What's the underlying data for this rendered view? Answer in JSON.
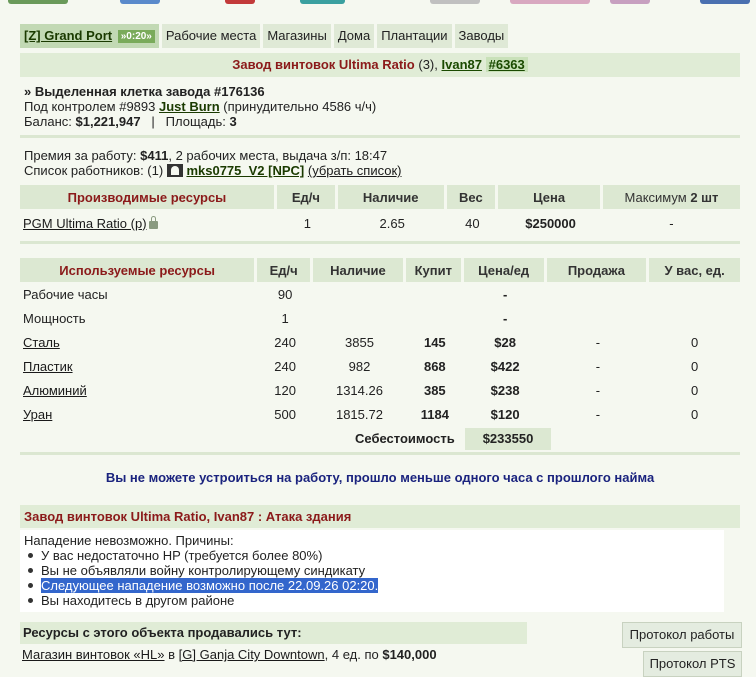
{
  "tabs": [
    {
      "label": "[Z] Grand Port",
      "timer": "»0:20»",
      "active": true
    },
    {
      "label": "Рабочие места"
    },
    {
      "label": "Магазины"
    },
    {
      "label": "Дома"
    },
    {
      "label": "Плантации"
    },
    {
      "label": "Заводы"
    }
  ],
  "title": {
    "name": "Завод винтовок Ultima Ratio",
    "count": "(3),",
    "owner": "Ivan87",
    "id": "#6363"
  },
  "info": {
    "cell_prefix": "» Выделенная клетка завода #176136",
    "control_prefix": "Под контролем #9893",
    "controller": "Just Burn",
    "control_suffix": "(принудительно 4586 ч/ч)",
    "balance_label": "Баланс:",
    "balance": "$1,221,947",
    "divider": "|",
    "area_label": "Площадь:",
    "area": "3"
  },
  "work": {
    "bonus_label": "Премия за работу:",
    "bonus": "$411",
    "bonus_rest": ", 2 рабочих места, выдача з/п: 18:47",
    "workers_label": "Список работников: (1)",
    "worker": "mks0775_V2 [NPC]",
    "remove_link": "(убрать список)"
  },
  "produced": {
    "headers": [
      "Производимые ресурсы",
      "Ед/ч",
      "Наличие",
      "Вес",
      "Цена"
    ],
    "max_label": "Максимум",
    "max_value": "2 шт",
    "rows": [
      {
        "name": "PGM Ultima Ratio (p)",
        "rate": "1",
        "stock": "2.65",
        "weight": "40",
        "price": "$250000",
        "max": "-"
      }
    ]
  },
  "used": {
    "headers": [
      "Используемые ресурсы",
      "Ед/ч",
      "Наличие",
      "Купит",
      "Цена/ед",
      "Продажа",
      "У вас, ед."
    ],
    "rows": [
      {
        "name": "Рабочие часы",
        "rate": "90",
        "stock": "",
        "buy": "",
        "price": "-",
        "sell": "",
        "have": "",
        "link": false
      },
      {
        "name": "Мощность",
        "rate": "1",
        "stock": "",
        "buy": "",
        "price": "-",
        "sell": "",
        "have": "",
        "link": false
      },
      {
        "name": "Сталь",
        "rate": "240",
        "stock": "3855",
        "buy": "145",
        "price": "$28",
        "sell": "-",
        "have": "0",
        "link": true
      },
      {
        "name": "Пластик",
        "rate": "240",
        "stock": "982",
        "buy": "868",
        "price": "$422",
        "sell": "-",
        "have": "0",
        "link": true
      },
      {
        "name": "Алюминий",
        "rate": "120",
        "stock": "1314.26",
        "buy": "385",
        "price": "$238",
        "sell": "-",
        "have": "0",
        "link": true
      },
      {
        "name": "Уран",
        "rate": "500",
        "stock": "1815.72",
        "buy": "1184",
        "price": "$120",
        "sell": "-",
        "have": "0",
        "link": true
      }
    ],
    "cost_label": "Себестоимость",
    "cost_value": "$233550"
  },
  "notice": "Вы не можете устроиться на работу, прошло меньше одного часа с прошлого найма",
  "attack": {
    "title": "Завод винтовок Ultima Ratio, Ivan87 : Атака здания",
    "header": "Нападение невозможно. Причины:",
    "reasons": [
      "У вас недостаточно HP (требуется более 80%)",
      "Вы не объявляли войну контролирующему синдикату",
      "Следующее нападение возможно после 22.09.26 02:20.",
      "Вы находитесь в другом районе"
    ]
  },
  "sold": {
    "title": "Ресурсы с этого объекта продавались тут:",
    "shop": "Магазин винтовок «HL»",
    "in": "в",
    "district": "[G] Ganja City Downtown",
    "qty": ", 4 ед. по",
    "price": "$140,000"
  },
  "buttons": {
    "work_log": "Протокол работы",
    "pts_log": "Протокол PTS"
  },
  "colors": {
    "accent_dark_red": "#8b1a1a",
    "band_green": "#e0ecd6",
    "notice_blue": "#1a237e",
    "selection": "#3366cc"
  }
}
